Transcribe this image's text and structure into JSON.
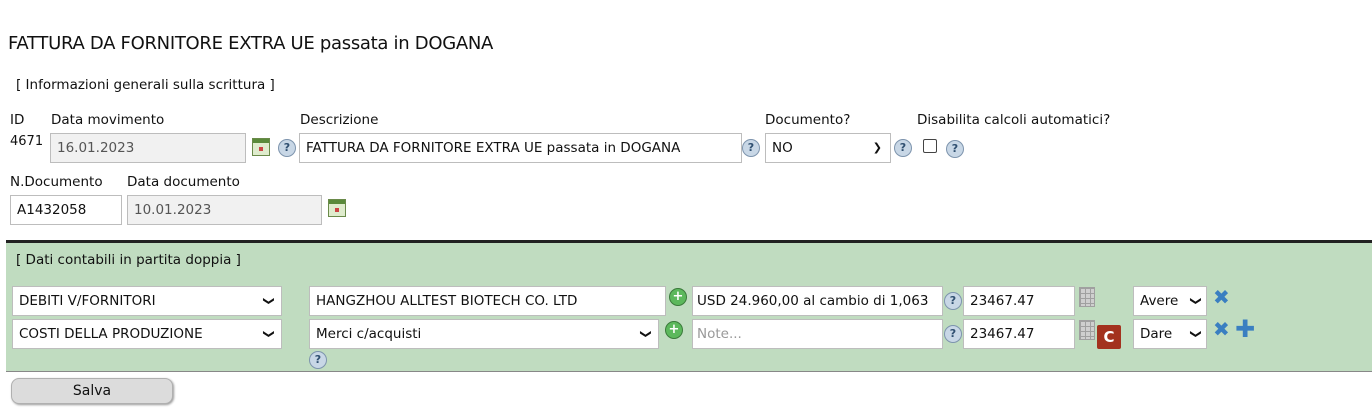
{
  "page": {
    "title": "FATTURA DA FORNITORE EXTRA UE passata in DOGANA"
  },
  "general": {
    "section_label": "[ Informazioni generali sulla scrittura ]",
    "labels": {
      "id": "ID",
      "data_movimento": "Data movimento",
      "descrizione": "Descrizione",
      "documento": "Documento?",
      "disabilita": "Disabilita calcoli automatici?",
      "n_documento": "N.Documento",
      "data_documento": "Data documento"
    },
    "id_value": "4671",
    "data_movimento": "16.01.2023",
    "descrizione": "FATTURA DA FORNITORE EXTRA UE passata in DOGANA",
    "documento": "NO",
    "disabilita_checked": false,
    "n_documento": "A1432058",
    "data_documento": "10.01.2023"
  },
  "accounting": {
    "section_label": "[ Dati contabili in partita doppia ]",
    "rows": [
      {
        "conto": "DEBITI V/FORNITORI",
        "sottoconto": "HANGZHOU ALLTEST BIOTECH CO. LTD",
        "note": "USD 24.960,00 al cambio di 1,063",
        "importo": "23467.47",
        "segno": "Avere"
      },
      {
        "conto": "COSTI DELLA PRODUZIONE",
        "sottoconto": "Merci c/acquisti",
        "note_placeholder": "Note...",
        "importo": "23467.47",
        "segno": "Dare",
        "c_label": "C"
      }
    ]
  },
  "actions": {
    "save_label": "Salva"
  },
  "icons": {
    "help": "?",
    "add_circle": "+",
    "remove": "✖",
    "add_row": "✚"
  },
  "colors": {
    "accounting_bg": "#c0dcc0",
    "c_button": "#a3321e",
    "icon_blue": "#3a7fc1"
  }
}
